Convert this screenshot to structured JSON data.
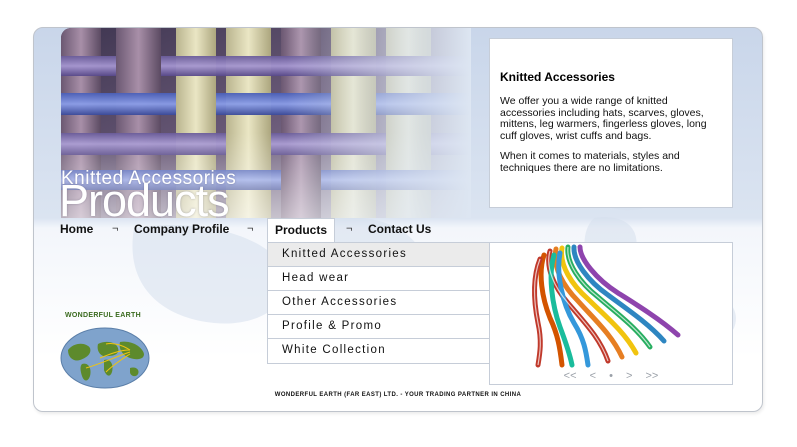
{
  "hero": {
    "subtitle": "Knitted Accessories",
    "title": "Products"
  },
  "info": {
    "heading": "Knitted Accessories",
    "paragraph1": "We offer you a wide range of knitted accessories including hats, scarves, gloves, mittens, leg warmers, fingerless gloves, long cuff gloves, wrist cuffs and bags.",
    "paragraph2": "When it comes to materials, styles and techniques there are no limitations."
  },
  "nav": {
    "items": [
      {
        "label": "Home"
      },
      {
        "label": "Company Profile"
      },
      {
        "label": "Products"
      },
      {
        "label": "Contact Us"
      }
    ],
    "separator": "¬",
    "active": "Products"
  },
  "dropdown": {
    "items": [
      {
        "label": "Knitted Accessories"
      },
      {
        "label": "Head wear"
      },
      {
        "label": "Other Accessories"
      },
      {
        "label": "Profile & Promo"
      },
      {
        "label": "White Collection"
      }
    ],
    "selected": "Knitted Accessories"
  },
  "gallery": {
    "controls": {
      "first": "<<",
      "prev": "<",
      "dot": "•",
      "next": ">",
      "last": ">>"
    }
  },
  "logo": {
    "text": "WONDERFUL EARTH"
  },
  "footer": {
    "text": "WONDERFUL EARTH (FAR EAST) LTD. - YOUR TRADING PARTNER IN CHINA"
  },
  "colors": {
    "frame_border": "#bfc4cc",
    "panel_border": "#c6cdd8",
    "selected_bg": "#ebebeb",
    "background_blue": "#c9d6ea"
  }
}
